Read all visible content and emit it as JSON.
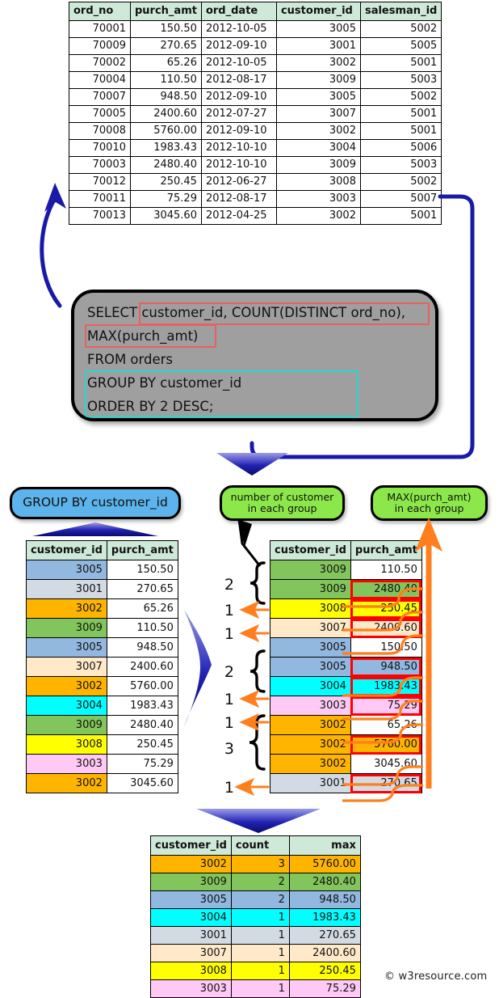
{
  "orders_table": {
    "name": "orders",
    "columns": [
      "ord_no",
      "purch_amt",
      "ord_date",
      "customer_id",
      "salesman_id"
    ],
    "rows": [
      [
        "70001",
        "150.50",
        "2012-10-05",
        "3005",
        "5002"
      ],
      [
        "70009",
        "270.65",
        "2012-09-10",
        "3001",
        "5005"
      ],
      [
        "70002",
        "65.26",
        "2012-10-05",
        "3002",
        "5001"
      ],
      [
        "70004",
        "110.50",
        "2012-08-17",
        "3009",
        "5003"
      ],
      [
        "70007",
        "948.50",
        "2012-09-10",
        "3005",
        "5002"
      ],
      [
        "70005",
        "2400.60",
        "2012-07-27",
        "3007",
        "5001"
      ],
      [
        "70008",
        "5760.00",
        "2012-09-10",
        "3002",
        "5001"
      ],
      [
        "70010",
        "1983.43",
        "2012-10-10",
        "3004",
        "5006"
      ],
      [
        "70003",
        "2480.40",
        "2012-10-10",
        "3009",
        "5003"
      ],
      [
        "70012",
        "250.45",
        "2012-06-27",
        "3008",
        "5002"
      ],
      [
        "70011",
        "75.29",
        "2012-08-17",
        "3003",
        "5007"
      ],
      [
        "70013",
        "3045.60",
        "2012-04-25",
        "3002",
        "5001"
      ]
    ]
  },
  "sql": {
    "line1": "SELECT customer_id, COUNT(DISTINCT ord_no),",
    "line2": "MAX(purch_amt)",
    "line3": "FROM orders",
    "line4": "GROUP BY customer_id",
    "line5": "ORDER BY 2 DESC;",
    "highlight_red_color": "#e86060",
    "highlight_cyan_color": "#28d6cf",
    "box_background": "#9f9f9f"
  },
  "labels": {
    "group_by": "GROUP BY customer_id",
    "group_by_color": "#5db3ec",
    "count_line1": "number of customer",
    "count_line2": "in each group",
    "max_line1": "MAX(purch_amt)",
    "max_line2": "in each group",
    "callout_color": "#8ce84a"
  },
  "left_table": {
    "columns": [
      "customer_id",
      "purch_amt"
    ],
    "rows": [
      {
        "customer_id": "3005",
        "purch_amt": "150.50"
      },
      {
        "customer_id": "3001",
        "purch_amt": "270.65"
      },
      {
        "customer_id": "3002",
        "purch_amt": "65.26"
      },
      {
        "customer_id": "3009",
        "purch_amt": "110.50"
      },
      {
        "customer_id": "3005",
        "purch_amt": "948.50"
      },
      {
        "customer_id": "3007",
        "purch_amt": "2400.60"
      },
      {
        "customer_id": "3002",
        "purch_amt": "5760.00"
      },
      {
        "customer_id": "3004",
        "purch_amt": "1983.43"
      },
      {
        "customer_id": "3009",
        "purch_amt": "2480.40"
      },
      {
        "customer_id": "3008",
        "purch_amt": "250.45"
      },
      {
        "customer_id": "3003",
        "purch_amt": "75.29"
      },
      {
        "customer_id": "3002",
        "purch_amt": "3045.60"
      }
    ]
  },
  "mid_table": {
    "columns": [
      "customer_id",
      "purch_amt"
    ],
    "rows": [
      {
        "customer_id": "3009",
        "purch_amt": "110.50",
        "max_boxed": false
      },
      {
        "customer_id": "3009",
        "purch_amt": "2480.40",
        "max_boxed": true
      },
      {
        "customer_id": "3008",
        "purch_amt": "250.45",
        "max_boxed": true
      },
      {
        "customer_id": "3007",
        "purch_amt": "2400.60",
        "max_boxed": true
      },
      {
        "customer_id": "3005",
        "purch_amt": "150.50",
        "max_boxed": false
      },
      {
        "customer_id": "3005",
        "purch_amt": "948.50",
        "max_boxed": true
      },
      {
        "customer_id": "3004",
        "purch_amt": "1983.43",
        "max_boxed": true
      },
      {
        "customer_id": "3003",
        "purch_amt": "75.29",
        "max_boxed": true
      },
      {
        "customer_id": "3002",
        "purch_amt": "65.26",
        "max_boxed": false
      },
      {
        "customer_id": "3002",
        "purch_amt": "5760.00",
        "max_boxed": true
      },
      {
        "customer_id": "3002",
        "purch_amt": "3045.60",
        "max_boxed": false
      },
      {
        "customer_id": "3001",
        "purch_amt": "270.65",
        "max_boxed": true
      }
    ],
    "group_counts": [
      "2",
      "1",
      "1",
      "2",
      "1",
      "1",
      "3",
      "1"
    ]
  },
  "final_table": {
    "columns": [
      "customer_id",
      "count",
      "max"
    ],
    "rows": [
      {
        "customer_id": "3002",
        "count": "3",
        "max": "5760.00"
      },
      {
        "customer_id": "3009",
        "count": "2",
        "max": "2480.40"
      },
      {
        "customer_id": "3005",
        "count": "2",
        "max": "948.50"
      },
      {
        "customer_id": "3004",
        "count": "1",
        "max": "1983.43"
      },
      {
        "customer_id": "3001",
        "count": "1",
        "max": "270.65"
      },
      {
        "customer_id": "3007",
        "count": "1",
        "max": "2400.60"
      },
      {
        "customer_id": "3008",
        "count": "1",
        "max": "250.45"
      },
      {
        "customer_id": "3003",
        "count": "1",
        "max": "75.29"
      }
    ]
  },
  "watermark": "© w3resource.com",
  "colors": {
    "arrow_blue": "#1a1aa8",
    "arrow_orange": "#ff7f1e",
    "header_green": "#cfe9d8",
    "box_red": "#ff0000"
  }
}
